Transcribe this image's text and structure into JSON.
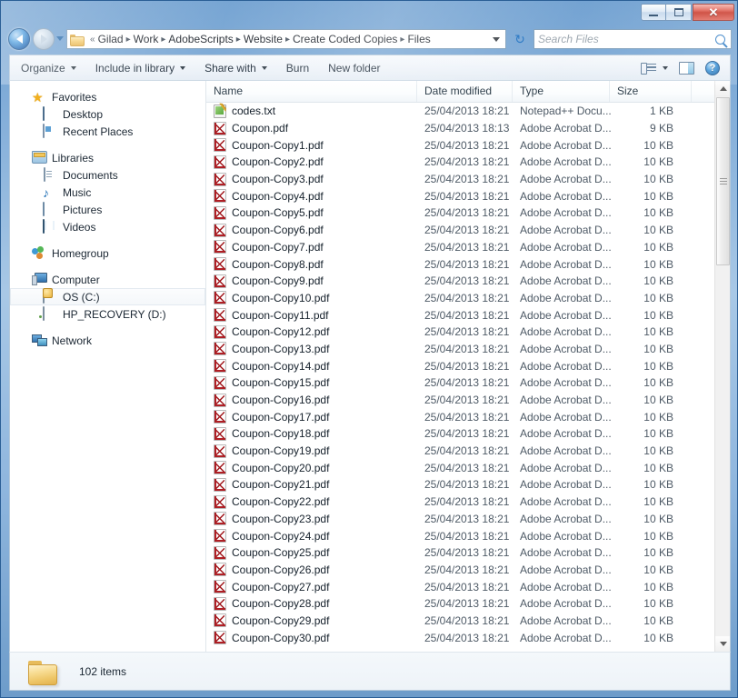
{
  "window": {
    "controls": {
      "minimize": "Minimize",
      "maximize": "Maximize",
      "close": "✕"
    }
  },
  "nav": {
    "back_label": "Back",
    "forward_label": "Forward",
    "history_label": "Recent pages",
    "refresh_label": "↻",
    "breadcrumb_prefix": "«",
    "breadcrumbs": [
      "Gilad",
      "Work",
      "AdobeScripts",
      "Website",
      "Create Coded Copies",
      "Files"
    ],
    "separator": "▸",
    "address_dropdown_label": "Previous locations"
  },
  "search": {
    "placeholder": "Search Files",
    "icon": "search-icon"
  },
  "toolbar": {
    "items": [
      {
        "label": "Organize",
        "has_caret": true
      },
      {
        "label": "Include in library",
        "has_caret": true
      },
      {
        "label": "Share with",
        "has_caret": true
      },
      {
        "label": "Burn",
        "has_caret": false
      },
      {
        "label": "New folder",
        "has_caret": false
      }
    ],
    "right_icons": [
      {
        "name": "change-view-icon",
        "label": "Change your view"
      },
      {
        "name": "view-dropdown-icon",
        "label": "More options"
      },
      {
        "name": "preview-pane-icon",
        "label": "Show the preview pane"
      },
      {
        "name": "help-icon",
        "label": "?"
      }
    ]
  },
  "sidebar": {
    "groups": [
      {
        "header": {
          "label": "Favorites",
          "icon": "star-icon"
        },
        "items": [
          {
            "label": "Desktop",
            "icon": "desktop-icon"
          },
          {
            "label": "Recent Places",
            "icon": "recent-places-icon"
          }
        ]
      },
      {
        "header": {
          "label": "Libraries",
          "icon": "libraries-icon"
        },
        "items": [
          {
            "label": "Documents",
            "icon": "documents-icon"
          },
          {
            "label": "Music",
            "icon": "music-icon"
          },
          {
            "label": "Pictures",
            "icon": "pictures-icon"
          },
          {
            "label": "Videos",
            "icon": "videos-icon"
          }
        ]
      },
      {
        "header": {
          "label": "Homegroup",
          "icon": "homegroup-icon"
        },
        "items": []
      },
      {
        "header": {
          "label": "Computer",
          "icon": "computer-icon"
        },
        "items": [
          {
            "label": "OS (C:)",
            "icon": "os-drive-icon",
            "selected": true
          },
          {
            "label": "HP_RECOVERY (D:)",
            "icon": "recovery-drive-icon"
          }
        ]
      },
      {
        "header": {
          "label": "Network",
          "icon": "network-icon"
        },
        "items": []
      }
    ]
  },
  "columns": [
    {
      "key": "name",
      "label": "Name"
    },
    {
      "key": "date",
      "label": "Date modified"
    },
    {
      "key": "type",
      "label": "Type"
    },
    {
      "key": "size",
      "label": "Size"
    }
  ],
  "files": [
    {
      "name": "codes.txt",
      "date": "25/04/2013 18:21",
      "type": "Notepad++ Docu...",
      "size": "1 KB",
      "icon": "text-file-icon"
    },
    {
      "name": "Coupon.pdf",
      "date": "25/04/2013 18:13",
      "type": "Adobe Acrobat D...",
      "size": "9 KB",
      "icon": "pdf-file-icon"
    },
    {
      "name": "Coupon-Copy1.pdf",
      "date": "25/04/2013 18:21",
      "type": "Adobe Acrobat D...",
      "size": "10 KB",
      "icon": "pdf-file-icon"
    },
    {
      "name": "Coupon-Copy2.pdf",
      "date": "25/04/2013 18:21",
      "type": "Adobe Acrobat D...",
      "size": "10 KB",
      "icon": "pdf-file-icon"
    },
    {
      "name": "Coupon-Copy3.pdf",
      "date": "25/04/2013 18:21",
      "type": "Adobe Acrobat D...",
      "size": "10 KB",
      "icon": "pdf-file-icon"
    },
    {
      "name": "Coupon-Copy4.pdf",
      "date": "25/04/2013 18:21",
      "type": "Adobe Acrobat D...",
      "size": "10 KB",
      "icon": "pdf-file-icon"
    },
    {
      "name": "Coupon-Copy5.pdf",
      "date": "25/04/2013 18:21",
      "type": "Adobe Acrobat D...",
      "size": "10 KB",
      "icon": "pdf-file-icon"
    },
    {
      "name": "Coupon-Copy6.pdf",
      "date": "25/04/2013 18:21",
      "type": "Adobe Acrobat D...",
      "size": "10 KB",
      "icon": "pdf-file-icon"
    },
    {
      "name": "Coupon-Copy7.pdf",
      "date": "25/04/2013 18:21",
      "type": "Adobe Acrobat D...",
      "size": "10 KB",
      "icon": "pdf-file-icon"
    },
    {
      "name": "Coupon-Copy8.pdf",
      "date": "25/04/2013 18:21",
      "type": "Adobe Acrobat D...",
      "size": "10 KB",
      "icon": "pdf-file-icon"
    },
    {
      "name": "Coupon-Copy9.pdf",
      "date": "25/04/2013 18:21",
      "type": "Adobe Acrobat D...",
      "size": "10 KB",
      "icon": "pdf-file-icon"
    },
    {
      "name": "Coupon-Copy10.pdf",
      "date": "25/04/2013 18:21",
      "type": "Adobe Acrobat D...",
      "size": "10 KB",
      "icon": "pdf-file-icon"
    },
    {
      "name": "Coupon-Copy11.pdf",
      "date": "25/04/2013 18:21",
      "type": "Adobe Acrobat D...",
      "size": "10 KB",
      "icon": "pdf-file-icon"
    },
    {
      "name": "Coupon-Copy12.pdf",
      "date": "25/04/2013 18:21",
      "type": "Adobe Acrobat D...",
      "size": "10 KB",
      "icon": "pdf-file-icon"
    },
    {
      "name": "Coupon-Copy13.pdf",
      "date": "25/04/2013 18:21",
      "type": "Adobe Acrobat D...",
      "size": "10 KB",
      "icon": "pdf-file-icon"
    },
    {
      "name": "Coupon-Copy14.pdf",
      "date": "25/04/2013 18:21",
      "type": "Adobe Acrobat D...",
      "size": "10 KB",
      "icon": "pdf-file-icon"
    },
    {
      "name": "Coupon-Copy15.pdf",
      "date": "25/04/2013 18:21",
      "type": "Adobe Acrobat D...",
      "size": "10 KB",
      "icon": "pdf-file-icon"
    },
    {
      "name": "Coupon-Copy16.pdf",
      "date": "25/04/2013 18:21",
      "type": "Adobe Acrobat D...",
      "size": "10 KB",
      "icon": "pdf-file-icon"
    },
    {
      "name": "Coupon-Copy17.pdf",
      "date": "25/04/2013 18:21",
      "type": "Adobe Acrobat D...",
      "size": "10 KB",
      "icon": "pdf-file-icon"
    },
    {
      "name": "Coupon-Copy18.pdf",
      "date": "25/04/2013 18:21",
      "type": "Adobe Acrobat D...",
      "size": "10 KB",
      "icon": "pdf-file-icon"
    },
    {
      "name": "Coupon-Copy19.pdf",
      "date": "25/04/2013 18:21",
      "type": "Adobe Acrobat D...",
      "size": "10 KB",
      "icon": "pdf-file-icon"
    },
    {
      "name": "Coupon-Copy20.pdf",
      "date": "25/04/2013 18:21",
      "type": "Adobe Acrobat D...",
      "size": "10 KB",
      "icon": "pdf-file-icon"
    },
    {
      "name": "Coupon-Copy21.pdf",
      "date": "25/04/2013 18:21",
      "type": "Adobe Acrobat D...",
      "size": "10 KB",
      "icon": "pdf-file-icon"
    },
    {
      "name": "Coupon-Copy22.pdf",
      "date": "25/04/2013 18:21",
      "type": "Adobe Acrobat D...",
      "size": "10 KB",
      "icon": "pdf-file-icon"
    },
    {
      "name": "Coupon-Copy23.pdf",
      "date": "25/04/2013 18:21",
      "type": "Adobe Acrobat D...",
      "size": "10 KB",
      "icon": "pdf-file-icon"
    },
    {
      "name": "Coupon-Copy24.pdf",
      "date": "25/04/2013 18:21",
      "type": "Adobe Acrobat D...",
      "size": "10 KB",
      "icon": "pdf-file-icon"
    },
    {
      "name": "Coupon-Copy25.pdf",
      "date": "25/04/2013 18:21",
      "type": "Adobe Acrobat D...",
      "size": "10 KB",
      "icon": "pdf-file-icon"
    },
    {
      "name": "Coupon-Copy26.pdf",
      "date": "25/04/2013 18:21",
      "type": "Adobe Acrobat D...",
      "size": "10 KB",
      "icon": "pdf-file-icon"
    },
    {
      "name": "Coupon-Copy27.pdf",
      "date": "25/04/2013 18:21",
      "type": "Adobe Acrobat D...",
      "size": "10 KB",
      "icon": "pdf-file-icon"
    },
    {
      "name": "Coupon-Copy28.pdf",
      "date": "25/04/2013 18:21",
      "type": "Adobe Acrobat D...",
      "size": "10 KB",
      "icon": "pdf-file-icon"
    },
    {
      "name": "Coupon-Copy29.pdf",
      "date": "25/04/2013 18:21",
      "type": "Adobe Acrobat D...",
      "size": "10 KB",
      "icon": "pdf-file-icon"
    },
    {
      "name": "Coupon-Copy30.pdf",
      "date": "25/04/2013 18:21",
      "type": "Adobe Acrobat D...",
      "size": "10 KB",
      "icon": "pdf-file-icon"
    }
  ],
  "status": {
    "item_count": "102 items",
    "folder_icon": "folder-icon"
  },
  "colors": {
    "accent": "#2f7cc4",
    "close_button": "#c8392b",
    "pdf_red": "#b11f25",
    "folder_yellow": "#eec667",
    "selection": "#eaf4fd"
  }
}
